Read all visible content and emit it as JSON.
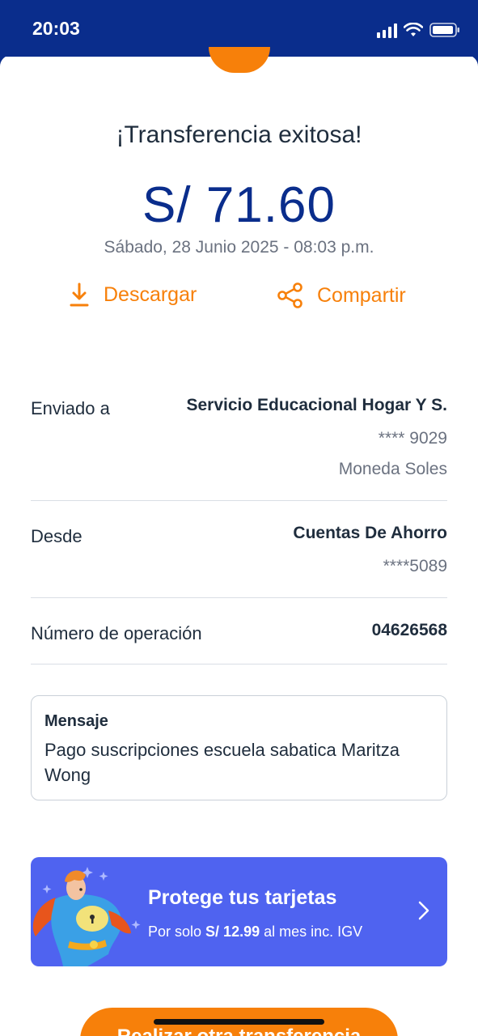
{
  "status_bar": {
    "time": "20:03"
  },
  "header": {
    "title": "¡Transferencia exitosa!"
  },
  "amount": "S/ 71.60",
  "datetime": "Sábado, 28 Junio 2025 - 08:03 p.m.",
  "actions": {
    "download_label": "Descargar",
    "share_label": "Compartir"
  },
  "details": {
    "sent_to": {
      "label": "Enviado a",
      "name": "Servicio Educacional Hogar Y S.",
      "account": "**** 9029",
      "currency": "Moneda Soles"
    },
    "from": {
      "label": "Desde",
      "account_type": "Cuentas De Ahorro",
      "account": "****5089"
    },
    "operation": {
      "label": "Número de operación",
      "number": "04626568"
    }
  },
  "message": {
    "title": "Mensaje",
    "text": "Pago suscripciones escuela sabatica Maritza Wong"
  },
  "promo": {
    "title": "Protege tus tarjetas",
    "prefix": "Por solo ",
    "price": "S/ 12.99",
    "suffix": " al mes inc. IGV"
  },
  "cta": {
    "label": "Realizar otra transferencia"
  },
  "colors": {
    "brand_blue": "#0a2d8c",
    "accent_orange": "#f7800a",
    "promo_blue": "#4f63f0"
  },
  "icons": [
    "signal-icon",
    "wifi-icon",
    "battery-icon",
    "download-icon",
    "share-icon",
    "superhero-illustration",
    "chevron-right-icon"
  ]
}
